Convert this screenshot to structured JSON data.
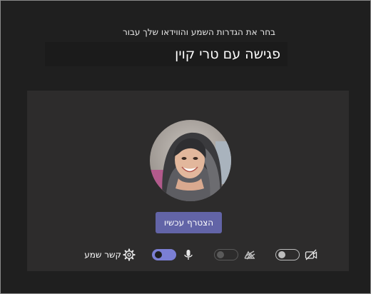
{
  "header": {
    "subtitle": "בחר את הגדרות השמע והווידאו שלך עבור",
    "meeting_title": "פגישה עם טרי קוין"
  },
  "preview": {
    "join_button_label": "הצטרף עכשיו"
  },
  "controls": {
    "video_toggle": {
      "state": "off",
      "icon": "video-off-icon"
    },
    "blur_toggle": {
      "state": "off",
      "enabled": false,
      "icon": "background-blur-icon"
    },
    "mic_toggle": {
      "state": "on",
      "icon": "microphone-icon"
    },
    "audio_settings": {
      "icon": "gear-icon",
      "label": "קשר שמע"
    }
  },
  "colors": {
    "background": "#1f1f1f",
    "panel": "#2d2c2c",
    "accent": "#6264a7",
    "toggle_on": "#7b7fd4"
  }
}
